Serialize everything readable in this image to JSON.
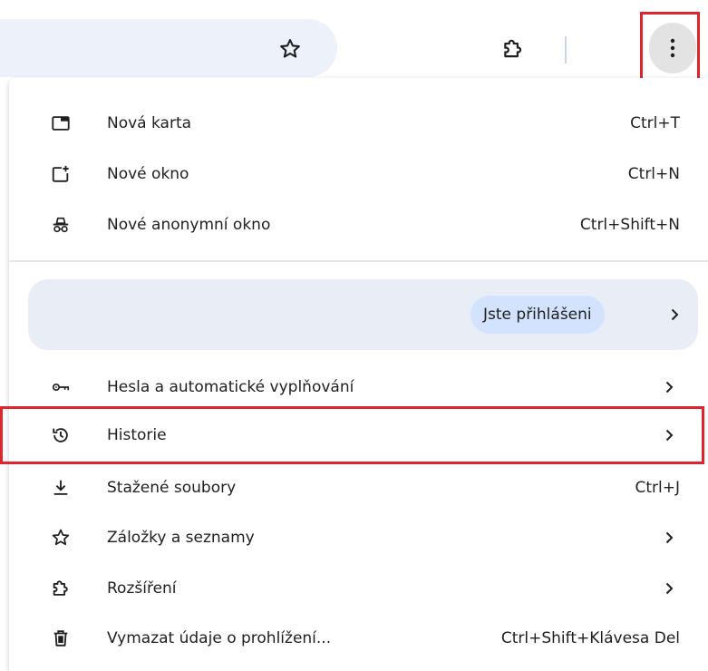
{
  "colors": {
    "omnibox_bg": "#edf2fa",
    "highlight": "#e0242e",
    "profile_card_bg": "#e9eef6",
    "signed_in_pill_bg": "#d3e3fd",
    "kebab_bg": "#e3e3e3"
  },
  "toolbar": {
    "icons": [
      "star-icon",
      "puzzle-icon",
      "more-vert-icon"
    ]
  },
  "menu": {
    "new_tab": {
      "label": "Nová karta",
      "shortcut": "Ctrl+T",
      "icon": "new-tab-icon"
    },
    "new_window": {
      "label": "Nové okno",
      "shortcut": "Ctrl+N",
      "icon": "new-window-icon"
    },
    "incognito": {
      "label": "Nové anonymní okno",
      "shortcut": "Ctrl+Shift+N",
      "icon": "incognito-icon"
    },
    "profile": {
      "status": "Jste přihlášeni"
    },
    "passwords": {
      "label": "Hesla a automatické vyplňování",
      "icon": "key-icon"
    },
    "history": {
      "label": "Historie",
      "icon": "history-icon"
    },
    "downloads": {
      "label": "Stažené soubory",
      "shortcut": "Ctrl+J",
      "icon": "download-icon"
    },
    "bookmarks": {
      "label": "Záložky a seznamy",
      "icon": "star-icon"
    },
    "extensions": {
      "label": "Rozšíření",
      "icon": "puzzle-icon"
    },
    "clear_data": {
      "label": "Vymazat údaje o prohlížení...",
      "shortcut": "Ctrl+Shift+Klávesa Del",
      "icon": "trash-icon"
    }
  }
}
